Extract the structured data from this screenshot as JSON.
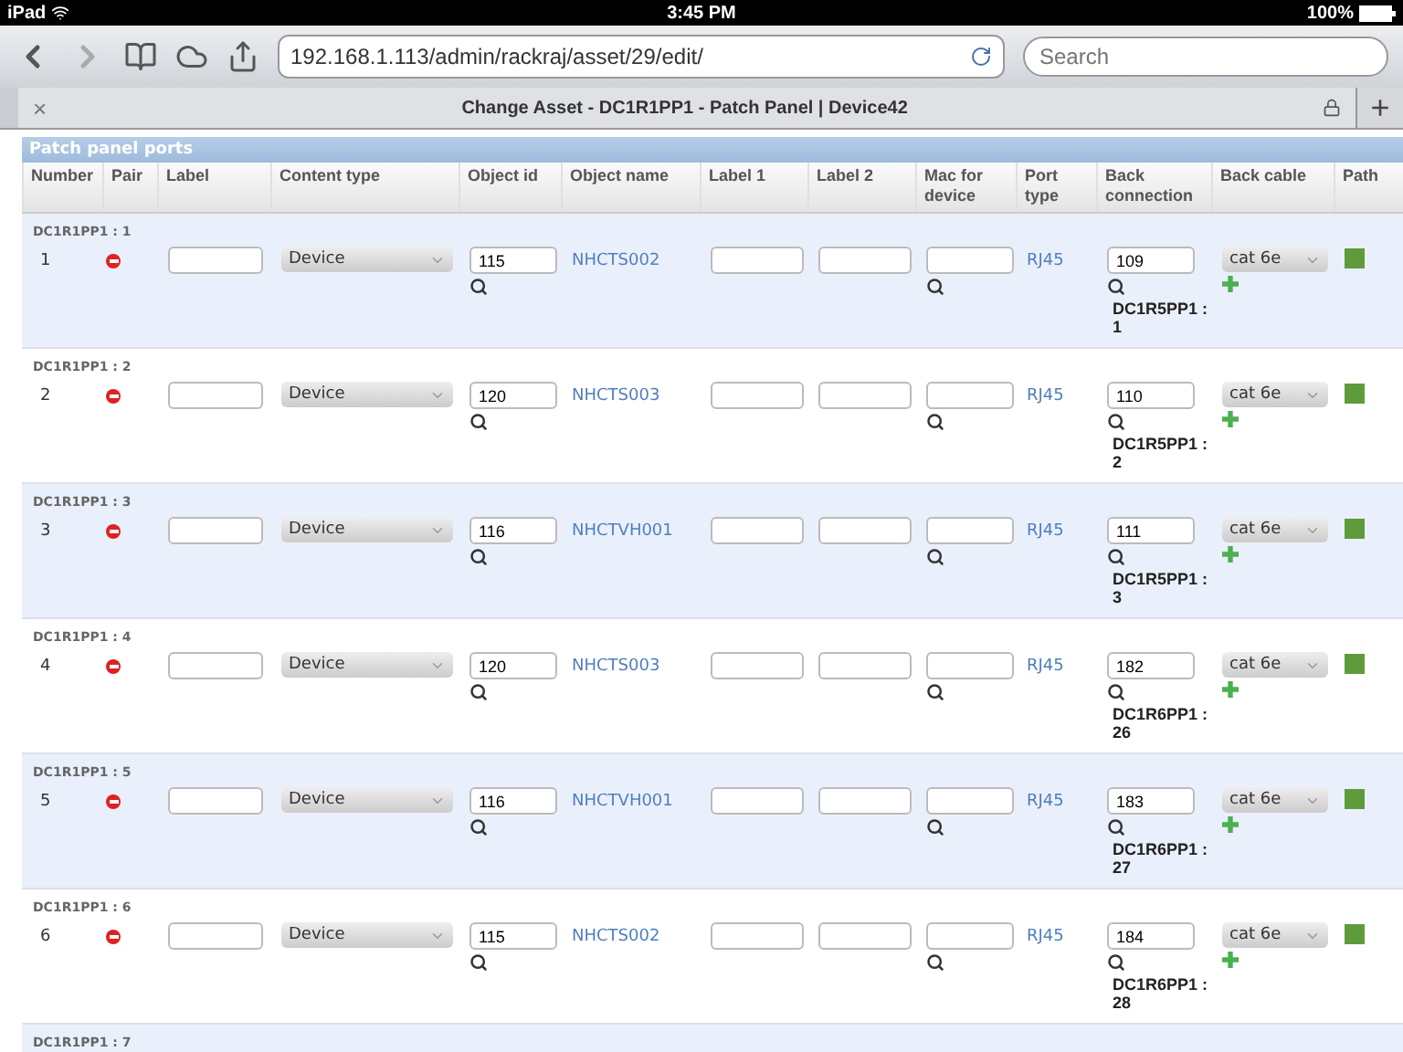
{
  "status_bar": {
    "device": "iPad",
    "time": "3:45 PM",
    "battery": "100%"
  },
  "browser": {
    "url": "192.168.1.113/admin/rackraj/asset/29/edit/",
    "search_placeholder": "Search",
    "tab_title": "Change Asset - DC1R1PP1 - Patch Panel | Device42",
    "close_glyph": "×",
    "new_tab_glyph": "+"
  },
  "section_title": "Patch panel ports",
  "columns": [
    "Number",
    "Pair",
    "Label",
    "Content type",
    "Object id",
    "Object name",
    "Label 1",
    "Label 2",
    "Mac for device",
    "Port type",
    "Back connection",
    "Back cable",
    "Path"
  ],
  "rows": [
    {
      "device_label": "DC1R1PP1 : 1",
      "number": "1",
      "content_type": "Device",
      "object_id": "115",
      "object_name": "NHCTS002",
      "port_type": "RJ45",
      "back_connection": "109",
      "back_connection_name": "DC1R5PP1 : 1",
      "back_cable": "cat 6e"
    },
    {
      "device_label": "DC1R1PP1 : 2",
      "number": "2",
      "content_type": "Device",
      "object_id": "120",
      "object_name": "NHCTS003",
      "port_type": "RJ45",
      "back_connection": "110",
      "back_connection_name": "DC1R5PP1 : 2",
      "back_cable": "cat 6e"
    },
    {
      "device_label": "DC1R1PP1 : 3",
      "number": "3",
      "content_type": "Device",
      "object_id": "116",
      "object_name": "NHCTVH001",
      "port_type": "RJ45",
      "back_connection": "111",
      "back_connection_name": "DC1R5PP1 : 3",
      "back_cable": "cat 6e"
    },
    {
      "device_label": "DC1R1PP1 : 4",
      "number": "4",
      "content_type": "Device",
      "object_id": "120",
      "object_name": "NHCTS003",
      "port_type": "RJ45",
      "back_connection": "182",
      "back_connection_name": "DC1R6PP1 : 26",
      "back_cable": "cat 6e"
    },
    {
      "device_label": "DC1R1PP1 : 5",
      "number": "5",
      "content_type": "Device",
      "object_id": "116",
      "object_name": "NHCTVH001",
      "port_type": "RJ45",
      "back_connection": "183",
      "back_connection_name": "DC1R6PP1 : 27",
      "back_cable": "cat 6e"
    },
    {
      "device_label": "DC1R1PP1 : 6",
      "number": "6",
      "content_type": "Device",
      "object_id": "115",
      "object_name": "NHCTS002",
      "port_type": "RJ45",
      "back_connection": "184",
      "back_connection_name": "DC1R6PP1 : 28",
      "back_cable": "cat 6e"
    }
  ],
  "next_row_label": "DC1R1PP1 : 7"
}
